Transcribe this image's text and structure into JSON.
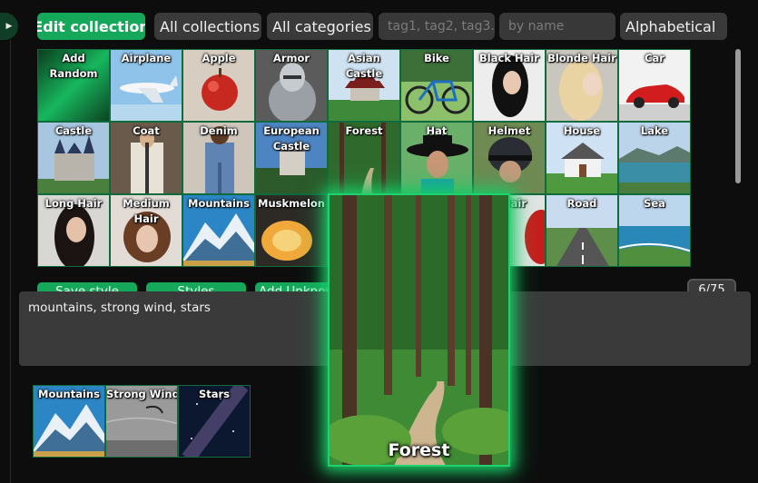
{
  "toolbar": {
    "edit_collection": "Edit collection",
    "collections": "All collections",
    "categories": "All categories",
    "tags_placeholder": "tag1, tag2, tag3...",
    "name_placeholder": "by name",
    "sort": "Alphabetical"
  },
  "grid": {
    "tiles": [
      {
        "label": "Add Random"
      },
      {
        "label": "Airplane"
      },
      {
        "label": "Apple"
      },
      {
        "label": "Armor"
      },
      {
        "label": "Asian Castle"
      },
      {
        "label": "Bike"
      },
      {
        "label": "Black Hair"
      },
      {
        "label": "Blonde Hair"
      },
      {
        "label": "Car"
      },
      {
        "label": "Castle"
      },
      {
        "label": "Coat"
      },
      {
        "label": "Denim"
      },
      {
        "label": "European Castle"
      },
      {
        "label": "Forest"
      },
      {
        "label": "Hat"
      },
      {
        "label": "Helmet"
      },
      {
        "label": "House"
      },
      {
        "label": "Lake"
      },
      {
        "label": "Long Hair"
      },
      {
        "label": "Medium Hair"
      },
      {
        "label": "Mountains"
      },
      {
        "label": "Muskmelon"
      },
      {
        "label": ""
      },
      {
        "label": ""
      },
      {
        "label": "Hair"
      },
      {
        "label": "Road"
      },
      {
        "label": "Sea"
      }
    ]
  },
  "actions": {
    "save_style": "Save style",
    "styles": "Styles",
    "add_unknown": "Add Unknown"
  },
  "counter": "6/75",
  "prompt": {
    "text": "mountains, strong wind, stars"
  },
  "preview": {
    "label": "Forest"
  },
  "selected_tags": [
    {
      "label": "Mountains"
    },
    {
      "label": "Strong Wind"
    },
    {
      "label": "Stars"
    }
  ],
  "colors": {
    "accent": "#15a85a",
    "glow": "#1dd36f"
  },
  "icons": {
    "side_toggle": "triangle-right-icon"
  }
}
